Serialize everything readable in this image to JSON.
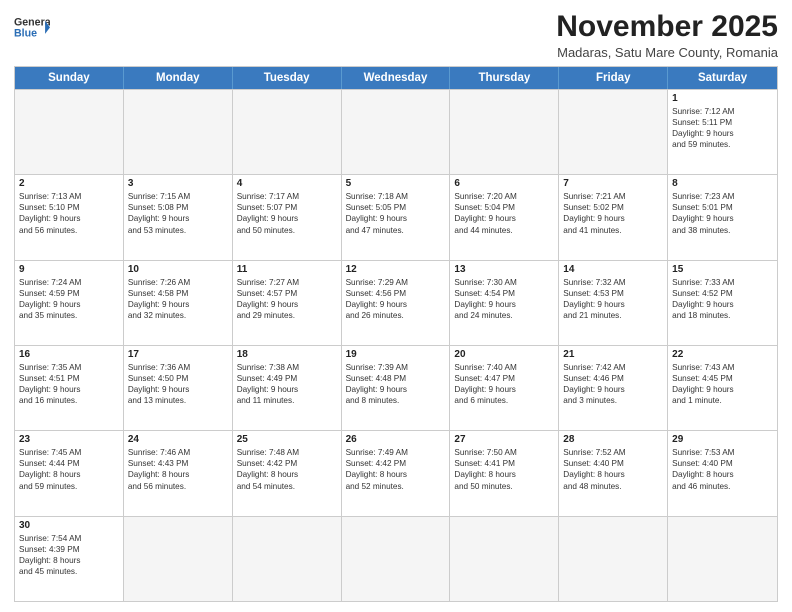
{
  "header": {
    "logo_general": "General",
    "logo_blue": "Blue",
    "month_year": "November 2025",
    "location": "Madaras, Satu Mare County, Romania"
  },
  "weekdays": [
    "Sunday",
    "Monday",
    "Tuesday",
    "Wednesday",
    "Thursday",
    "Friday",
    "Saturday"
  ],
  "rows": [
    [
      {
        "day": "",
        "info": ""
      },
      {
        "day": "",
        "info": ""
      },
      {
        "day": "",
        "info": ""
      },
      {
        "day": "",
        "info": ""
      },
      {
        "day": "",
        "info": ""
      },
      {
        "day": "",
        "info": ""
      },
      {
        "day": "1",
        "info": "Sunrise: 7:12 AM\nSunset: 5:11 PM\nDaylight: 9 hours\nand 59 minutes."
      }
    ],
    [
      {
        "day": "2",
        "info": "Sunrise: 7:13 AM\nSunset: 5:10 PM\nDaylight: 9 hours\nand 56 minutes."
      },
      {
        "day": "3",
        "info": "Sunrise: 7:15 AM\nSunset: 5:08 PM\nDaylight: 9 hours\nand 53 minutes."
      },
      {
        "day": "4",
        "info": "Sunrise: 7:17 AM\nSunset: 5:07 PM\nDaylight: 9 hours\nand 50 minutes."
      },
      {
        "day": "5",
        "info": "Sunrise: 7:18 AM\nSunset: 5:05 PM\nDaylight: 9 hours\nand 47 minutes."
      },
      {
        "day": "6",
        "info": "Sunrise: 7:20 AM\nSunset: 5:04 PM\nDaylight: 9 hours\nand 44 minutes."
      },
      {
        "day": "7",
        "info": "Sunrise: 7:21 AM\nSunset: 5:02 PM\nDaylight: 9 hours\nand 41 minutes."
      },
      {
        "day": "8",
        "info": "Sunrise: 7:23 AM\nSunset: 5:01 PM\nDaylight: 9 hours\nand 38 minutes."
      }
    ],
    [
      {
        "day": "9",
        "info": "Sunrise: 7:24 AM\nSunset: 4:59 PM\nDaylight: 9 hours\nand 35 minutes."
      },
      {
        "day": "10",
        "info": "Sunrise: 7:26 AM\nSunset: 4:58 PM\nDaylight: 9 hours\nand 32 minutes."
      },
      {
        "day": "11",
        "info": "Sunrise: 7:27 AM\nSunset: 4:57 PM\nDaylight: 9 hours\nand 29 minutes."
      },
      {
        "day": "12",
        "info": "Sunrise: 7:29 AM\nSunset: 4:56 PM\nDaylight: 9 hours\nand 26 minutes."
      },
      {
        "day": "13",
        "info": "Sunrise: 7:30 AM\nSunset: 4:54 PM\nDaylight: 9 hours\nand 24 minutes."
      },
      {
        "day": "14",
        "info": "Sunrise: 7:32 AM\nSunset: 4:53 PM\nDaylight: 9 hours\nand 21 minutes."
      },
      {
        "day": "15",
        "info": "Sunrise: 7:33 AM\nSunset: 4:52 PM\nDaylight: 9 hours\nand 18 minutes."
      }
    ],
    [
      {
        "day": "16",
        "info": "Sunrise: 7:35 AM\nSunset: 4:51 PM\nDaylight: 9 hours\nand 16 minutes."
      },
      {
        "day": "17",
        "info": "Sunrise: 7:36 AM\nSunset: 4:50 PM\nDaylight: 9 hours\nand 13 minutes."
      },
      {
        "day": "18",
        "info": "Sunrise: 7:38 AM\nSunset: 4:49 PM\nDaylight: 9 hours\nand 11 minutes."
      },
      {
        "day": "19",
        "info": "Sunrise: 7:39 AM\nSunset: 4:48 PM\nDaylight: 9 hours\nand 8 minutes."
      },
      {
        "day": "20",
        "info": "Sunrise: 7:40 AM\nSunset: 4:47 PM\nDaylight: 9 hours\nand 6 minutes."
      },
      {
        "day": "21",
        "info": "Sunrise: 7:42 AM\nSunset: 4:46 PM\nDaylight: 9 hours\nand 3 minutes."
      },
      {
        "day": "22",
        "info": "Sunrise: 7:43 AM\nSunset: 4:45 PM\nDaylight: 9 hours\nand 1 minute."
      }
    ],
    [
      {
        "day": "23",
        "info": "Sunrise: 7:45 AM\nSunset: 4:44 PM\nDaylight: 8 hours\nand 59 minutes."
      },
      {
        "day": "24",
        "info": "Sunrise: 7:46 AM\nSunset: 4:43 PM\nDaylight: 8 hours\nand 56 minutes."
      },
      {
        "day": "25",
        "info": "Sunrise: 7:48 AM\nSunset: 4:42 PM\nDaylight: 8 hours\nand 54 minutes."
      },
      {
        "day": "26",
        "info": "Sunrise: 7:49 AM\nSunset: 4:42 PM\nDaylight: 8 hours\nand 52 minutes."
      },
      {
        "day": "27",
        "info": "Sunrise: 7:50 AM\nSunset: 4:41 PM\nDaylight: 8 hours\nand 50 minutes."
      },
      {
        "day": "28",
        "info": "Sunrise: 7:52 AM\nSunset: 4:40 PM\nDaylight: 8 hours\nand 48 minutes."
      },
      {
        "day": "29",
        "info": "Sunrise: 7:53 AM\nSunset: 4:40 PM\nDaylight: 8 hours\nand 46 minutes."
      }
    ],
    [
      {
        "day": "30",
        "info": "Sunrise: 7:54 AM\nSunset: 4:39 PM\nDaylight: 8 hours\nand 45 minutes."
      },
      {
        "day": "",
        "info": ""
      },
      {
        "day": "",
        "info": ""
      },
      {
        "day": "",
        "info": ""
      },
      {
        "day": "",
        "info": ""
      },
      {
        "day": "",
        "info": ""
      },
      {
        "day": "",
        "info": ""
      }
    ]
  ]
}
